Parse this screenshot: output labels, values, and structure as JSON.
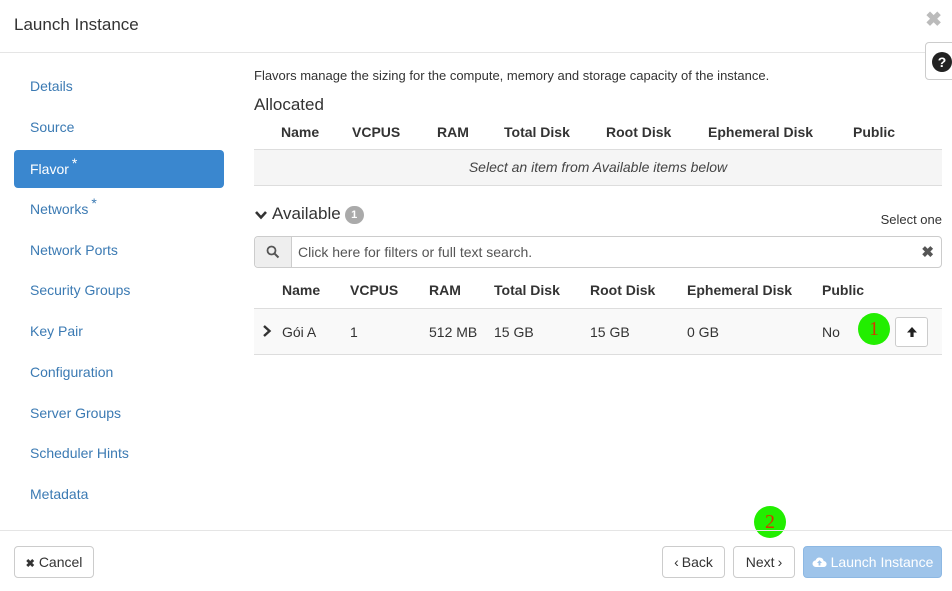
{
  "modal": {
    "title": "Launch Instance",
    "close_glyph": "✖",
    "help_glyph": "?"
  },
  "sidebar": {
    "items": [
      {
        "label": "Details",
        "required": false,
        "active": false
      },
      {
        "label": "Source",
        "required": false,
        "active": false
      },
      {
        "label": "Flavor",
        "required": true,
        "active": true
      },
      {
        "label": "Networks",
        "required": true,
        "active": false
      },
      {
        "label": "Network Ports",
        "required": false,
        "active": false
      },
      {
        "label": "Security Groups",
        "required": false,
        "active": false
      },
      {
        "label": "Key Pair",
        "required": false,
        "active": false
      },
      {
        "label": "Configuration",
        "required": false,
        "active": false
      },
      {
        "label": "Server Groups",
        "required": false,
        "active": false
      },
      {
        "label": "Scheduler Hints",
        "required": false,
        "active": false
      },
      {
        "label": "Metadata",
        "required": false,
        "active": false
      }
    ],
    "required_mark": "*"
  },
  "main": {
    "intro": "Flavors manage the sizing for the compute, memory and storage capacity of the instance.",
    "allocated": {
      "heading": "Allocated",
      "columns": [
        "Name",
        "VCPUS",
        "RAM",
        "Total Disk",
        "Root Disk",
        "Ephemeral Disk",
        "Public"
      ],
      "empty_message": "Select an item from Available items below"
    },
    "available": {
      "heading": "Available",
      "count": "1",
      "select_hint": "Select one",
      "search_placeholder": "Click here for filters or full text search.",
      "clear_glyph": "✖",
      "columns": [
        "Name",
        "VCPUS",
        "RAM",
        "Total Disk",
        "Root Disk",
        "Ephemeral Disk",
        "Public"
      ],
      "rows": [
        {
          "name": "Gói A",
          "vcpus": "1",
          "ram": "512 MB",
          "total_disk": "15 GB",
          "root_disk": "15 GB",
          "ephemeral_disk": "0 GB",
          "public": "No"
        }
      ]
    }
  },
  "annotations": {
    "marker_1": "1",
    "marker_2": "2",
    "color": "#22ee00"
  },
  "footer": {
    "cancel": "Cancel",
    "back": "Back",
    "next": "Next",
    "launch": "Launch Instance",
    "cancel_glyph": "✖",
    "back_glyph": "‹",
    "next_glyph": "›"
  },
  "colors": {
    "accent": "#3a87cf",
    "link": "#3b7ab3",
    "primary_disabled": "#9ec4ea"
  }
}
